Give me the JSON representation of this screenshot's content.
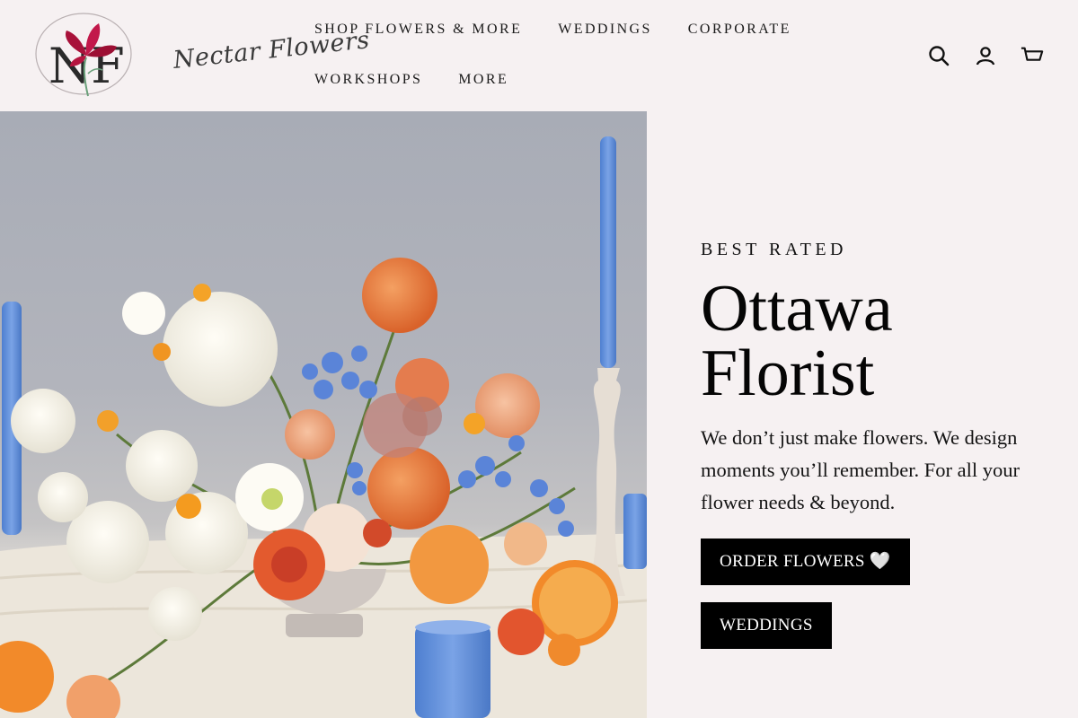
{
  "brand": {
    "monogram": "NF",
    "name": "Nectar Flowers"
  },
  "nav": {
    "row1": [
      "SHOP FLOWERS & MORE",
      "WEDDINGS",
      "CORPORATE"
    ],
    "row2": [
      "WORKSHOPS",
      "MORE"
    ]
  },
  "header_icons": [
    "search-icon",
    "account-icon",
    "cart-icon"
  ],
  "hero": {
    "eyebrow": "BEST RATED",
    "headline": "Ottawa Florist",
    "subtext": "We don’t just make flowers. We design moments you’ll remember. For all your flower needs & beyond.",
    "primary_button": "ORDER FLOWERS 🤍",
    "secondary_button": "WEDDINGS"
  },
  "colors": {
    "background": "#f6f1f2",
    "button": "#000000",
    "button_text": "#ffffff",
    "logo_flower": "#b5153f"
  }
}
